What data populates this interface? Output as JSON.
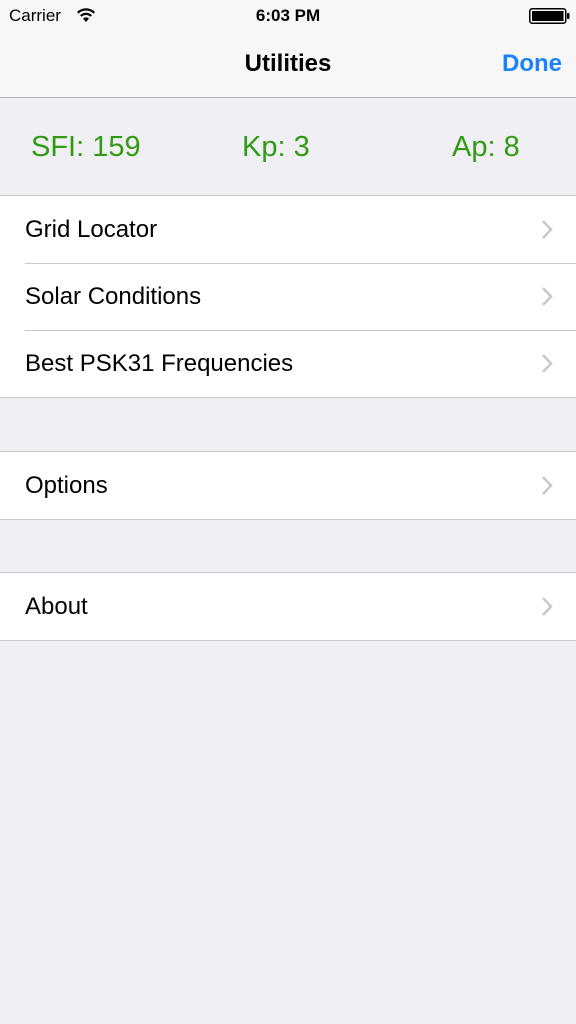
{
  "status_bar": {
    "carrier": "Carrier",
    "time": "6:03 PM",
    "wifi_icon": "wifi-icon",
    "battery_icon": "battery-icon"
  },
  "nav": {
    "title": "Utilities",
    "done_label": "Done",
    "accent_color": "#1a82fb"
  },
  "solar": {
    "sfi": "SFI: 159",
    "kp": "Kp: 3",
    "ap": "Ap: 8",
    "color": "#329b14"
  },
  "groups": [
    {
      "items": [
        {
          "label": "Grid Locator",
          "icon": "chevron-right-icon"
        },
        {
          "label": "Solar Conditions",
          "icon": "chevron-right-icon"
        },
        {
          "label": "Best PSK31 Frequencies",
          "icon": "chevron-right-icon"
        }
      ]
    },
    {
      "items": [
        {
          "label": "Options",
          "icon": "chevron-right-icon"
        }
      ]
    },
    {
      "items": [
        {
          "label": "About",
          "icon": "chevron-right-icon"
        }
      ]
    }
  ]
}
